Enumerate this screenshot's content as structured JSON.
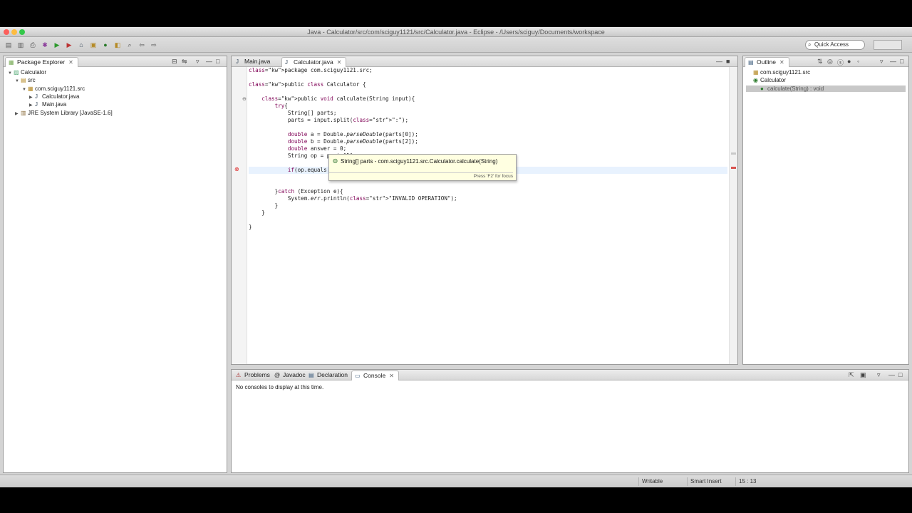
{
  "window": {
    "title": "Java - Calculator/src/com/sciguy1121/src/Calculator.java - Eclipse - /Users/sciguy/Documents/workspace",
    "traffic_colors": [
      "#fc605c",
      "#fdbc40",
      "#34c84a"
    ]
  },
  "toolbar": {
    "icons": [
      "new-icon",
      "save-icon",
      "print-icon",
      "debug-icon",
      "run-icon",
      "external-tools-icon",
      "new-java-project-icon",
      "new-package-icon",
      "new-class-icon",
      "open-type-icon",
      "search-icon",
      "back-icon",
      "forward-icon"
    ],
    "quick_access": "Quick Access"
  },
  "package_explorer": {
    "tab_label": "Package Explorer",
    "tree": [
      {
        "label": "Calculator",
        "depth": 0,
        "expanded": true,
        "icon": "project-icon"
      },
      {
        "label": "src",
        "depth": 1,
        "expanded": true,
        "icon": "source-folder-icon"
      },
      {
        "label": "com.sciguy1121.src",
        "depth": 2,
        "expanded": true,
        "icon": "package-icon"
      },
      {
        "label": "Calculator.java",
        "depth": 3,
        "expanded": false,
        "icon": "java-file-icon"
      },
      {
        "label": "Main.java",
        "depth": 3,
        "expanded": false,
        "icon": "java-file-icon"
      },
      {
        "label": "JRE System Library [JavaSE-1.6]",
        "depth": 1,
        "expanded": false,
        "icon": "library-icon"
      }
    ]
  },
  "editor": {
    "tabs": [
      {
        "label": "Main.java",
        "active": false
      },
      {
        "label": "Calculator.java",
        "active": true
      }
    ],
    "lines": [
      {
        "n": 0,
        "text": "package com.sciguy1121.src;"
      },
      {
        "n": 2,
        "text": "public class Calculator {"
      },
      {
        "n": 4,
        "text": "    public void calculate(String input){"
      },
      {
        "n": 5,
        "text": "        try{"
      },
      {
        "n": 6,
        "text": "            String[] parts;"
      },
      {
        "n": 7,
        "text": "            parts = input.split(\":\");"
      },
      {
        "n": 9,
        "text": "            double a = Double.parseDouble(parts[0]);"
      },
      {
        "n": 10,
        "text": "            double b = Double.parseDouble(parts[2]);"
      },
      {
        "n": 11,
        "text": "            double answer = 0;"
      },
      {
        "n": 12,
        "text": "            String op = parts[1];"
      },
      {
        "n": 14,
        "text": "            if(op.equals"
      },
      {
        "n": 17,
        "text": "        }catch (Exception e){"
      },
      {
        "n": 18,
        "text": "            System.err.println(\"INVALID OPERATION\");"
      },
      {
        "n": 19,
        "text": "        }"
      },
      {
        "n": 20,
        "text": "    }"
      },
      {
        "n": 22,
        "text": "}"
      }
    ],
    "hover": {
      "title": "String[] parts - com.sciguy1121.src.Calculator.calculate(String)",
      "footer": "Press 'F2' for focus"
    }
  },
  "outline": {
    "tab_label": "Outline",
    "items": [
      {
        "label": "com.sciguy1121.src",
        "depth": 0
      },
      {
        "label": "Calculator",
        "depth": 0
      },
      {
        "label": "calculate(String) : void",
        "depth": 1,
        "selected": true
      }
    ]
  },
  "console_panel": {
    "tabs": [
      "Problems",
      "Javadoc",
      "Declaration",
      "Console"
    ],
    "active_tab": "Console",
    "message": "No consoles to display at this time."
  },
  "statusbar": {
    "writable": "Writable",
    "insert_mode": "Smart Insert",
    "position": "15 : 13"
  }
}
